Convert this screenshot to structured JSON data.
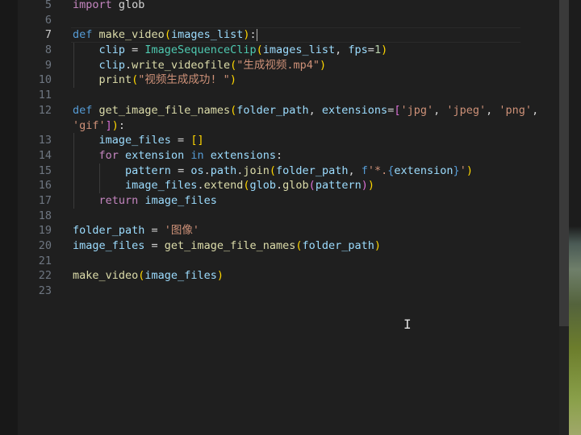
{
  "editor": {
    "lines": [
      {
        "num": "5",
        "tokens": [
          [
            "kw",
            "import"
          ],
          [
            "op",
            " glob"
          ]
        ]
      },
      {
        "num": "6",
        "tokens": []
      },
      {
        "num": "7",
        "tokens": [
          [
            "kwb",
            "def"
          ],
          [
            "op",
            " "
          ],
          [
            "fn",
            "make_video"
          ],
          [
            "br1",
            "("
          ],
          [
            "var",
            "images_list"
          ],
          [
            "br1",
            ")"
          ],
          [
            "op",
            ":"
          ]
        ]
      },
      {
        "num": "8",
        "tokens": [
          [
            "op",
            "    "
          ],
          [
            "var",
            "clip"
          ],
          [
            "op",
            " = "
          ],
          [
            "cls",
            "ImageSequenceClip"
          ],
          [
            "br1",
            "("
          ],
          [
            "var",
            "images_list"
          ],
          [
            "op",
            ", "
          ],
          [
            "var",
            "fps"
          ],
          [
            "op",
            "="
          ],
          [
            "num",
            "1"
          ],
          [
            "br1",
            ")"
          ]
        ]
      },
      {
        "num": "9",
        "tokens": [
          [
            "op",
            "    "
          ],
          [
            "var",
            "clip"
          ],
          [
            "op",
            "."
          ],
          [
            "fn",
            "write_videofile"
          ],
          [
            "br1",
            "("
          ],
          [
            "str",
            "\"生成视频.mp4\""
          ],
          [
            "br1",
            ")"
          ]
        ]
      },
      {
        "num": "10",
        "tokens": [
          [
            "op",
            "    "
          ],
          [
            "fn",
            "print"
          ],
          [
            "br1",
            "("
          ],
          [
            "str",
            "\"视频生成成功! \""
          ],
          [
            "br1",
            ")"
          ]
        ]
      },
      {
        "num": "11",
        "tokens": []
      },
      {
        "num": "12",
        "tokens": [
          [
            "kwb",
            "def"
          ],
          [
            "op",
            " "
          ],
          [
            "fn",
            "get_image_file_names"
          ],
          [
            "br1",
            "("
          ],
          [
            "var",
            "folder_path"
          ],
          [
            "op",
            ", "
          ],
          [
            "var",
            "extensions"
          ],
          [
            "op",
            "="
          ],
          [
            "br2",
            "["
          ],
          [
            "str",
            "'jpg'"
          ],
          [
            "op",
            ", "
          ],
          [
            "str",
            "'jpeg'"
          ],
          [
            "op",
            ", "
          ],
          [
            "str",
            "'png'"
          ],
          [
            "op",
            ","
          ]
        ]
      },
      {
        "num": "",
        "tokens": [
          [
            "str",
            "'gif'"
          ],
          [
            "br2",
            "]"
          ],
          [
            "br1",
            ")"
          ],
          [
            "op",
            ":"
          ]
        ]
      },
      {
        "num": "13",
        "tokens": [
          [
            "op",
            "    "
          ],
          [
            "var",
            "image_files"
          ],
          [
            "op",
            " = "
          ],
          [
            "br1",
            "[]"
          ]
        ]
      },
      {
        "num": "14",
        "tokens": [
          [
            "op",
            "    "
          ],
          [
            "kw",
            "for"
          ],
          [
            "op",
            " "
          ],
          [
            "var",
            "extension"
          ],
          [
            "op",
            " "
          ],
          [
            "kwb",
            "in"
          ],
          [
            "op",
            " "
          ],
          [
            "var",
            "extensions"
          ],
          [
            "op",
            ":"
          ]
        ]
      },
      {
        "num": "15",
        "tokens": [
          [
            "op",
            "        "
          ],
          [
            "var",
            "pattern"
          ],
          [
            "op",
            " = "
          ],
          [
            "var",
            "os"
          ],
          [
            "op",
            "."
          ],
          [
            "var",
            "path"
          ],
          [
            "op",
            "."
          ],
          [
            "fn",
            "join"
          ],
          [
            "br1",
            "("
          ],
          [
            "var",
            "folder_path"
          ],
          [
            "op",
            ", "
          ],
          [
            "kwb",
            "f"
          ],
          [
            "str",
            "'*."
          ],
          [
            "kwb",
            "{"
          ],
          [
            "var",
            "extension"
          ],
          [
            "kwb",
            "}"
          ],
          [
            "str",
            "'"
          ],
          [
            "br1",
            ")"
          ]
        ]
      },
      {
        "num": "16",
        "tokens": [
          [
            "op",
            "        "
          ],
          [
            "var",
            "image_files"
          ],
          [
            "op",
            "."
          ],
          [
            "fn",
            "extend"
          ],
          [
            "br1",
            "("
          ],
          [
            "var",
            "glob"
          ],
          [
            "op",
            "."
          ],
          [
            "fn",
            "glob"
          ],
          [
            "br2",
            "("
          ],
          [
            "var",
            "pattern"
          ],
          [
            "br2",
            ")"
          ],
          [
            "br1",
            ")"
          ]
        ]
      },
      {
        "num": "17",
        "tokens": [
          [
            "op",
            "    "
          ],
          [
            "kw",
            "return"
          ],
          [
            "op",
            " "
          ],
          [
            "var",
            "image_files"
          ]
        ]
      },
      {
        "num": "18",
        "tokens": []
      },
      {
        "num": "19",
        "tokens": [
          [
            "var",
            "folder_path"
          ],
          [
            "op",
            " = "
          ],
          [
            "str",
            "'图像'"
          ]
        ]
      },
      {
        "num": "20",
        "tokens": [
          [
            "var",
            "image_files"
          ],
          [
            "op",
            " = "
          ],
          [
            "fn",
            "get_image_file_names"
          ],
          [
            "br1",
            "("
          ],
          [
            "var",
            "folder_path"
          ],
          [
            "br1",
            ")"
          ]
        ]
      },
      {
        "num": "21",
        "tokens": []
      },
      {
        "num": "22",
        "tokens": [
          [
            "fn",
            "make_video"
          ],
          [
            "br1",
            "("
          ],
          [
            "var",
            "image_files"
          ],
          [
            "br1",
            ")"
          ]
        ]
      },
      {
        "num": "23",
        "tokens": []
      }
    ],
    "active_line": "7"
  },
  "colors": {
    "background": "#1f1f1f",
    "keyword_control": "#c586c0",
    "keyword": "#569cd6",
    "function": "#dcdcaa",
    "string": "#ce9178",
    "number": "#b5cea8",
    "variable": "#9cdcfe",
    "class": "#4ec9b0",
    "bracket_level1": "#ffd700",
    "bracket_level2": "#da70d6"
  },
  "icons": {
    "mouse_cursor": "i-beam-cursor-icon"
  }
}
